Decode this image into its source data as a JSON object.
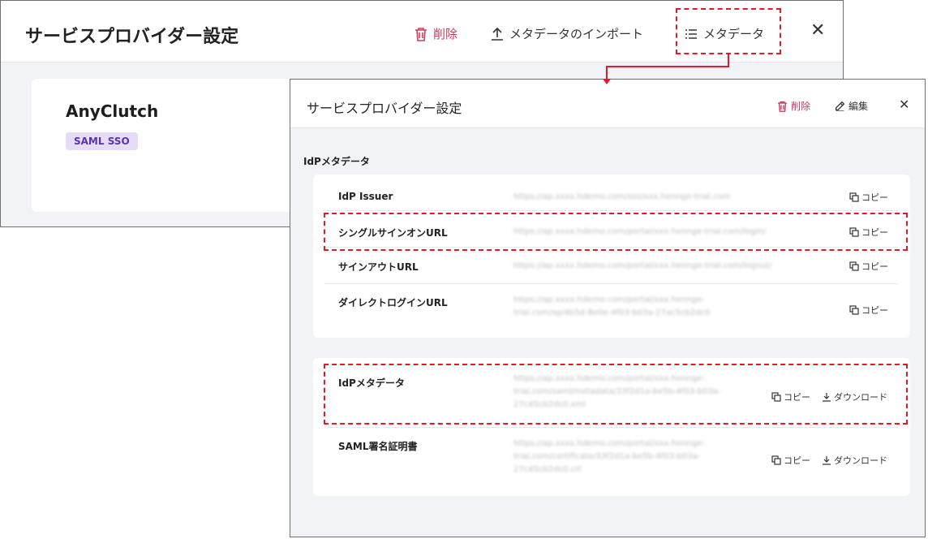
{
  "back_panel": {
    "title": "サービスプロバイダー設定",
    "actions": {
      "delete_label": "削除",
      "import_label": "メタデータのインポート",
      "metadata_label": "メタデータ"
    },
    "app_name": "AnyClutch",
    "badge": "SAML SSO"
  },
  "front_panel": {
    "title": "サービスプロバイダー設定",
    "delete_label": "削除",
    "edit_label": "編集",
    "section_title": "IdPメタデータ",
    "copy_label": "コピー",
    "download_label": "ダウンロード",
    "card1_rows": [
      {
        "label": "IdP Issuer",
        "value": "https://ap.xxxx.hdemo.com/sso/xxx.hennge-trial.com"
      },
      {
        "label": "シングルサインオンURL",
        "value": "https://ap.xxxx.hdemo.com/portal/xxx.hennge-trial.com/login/"
      },
      {
        "label": "サインアウトURL",
        "value": "https://ap.xxxx.hdemo.com/portal/xxx.hennge-trial.com/logout/"
      },
      {
        "label": "ダイレクトログインURL",
        "value": "https://ap.xxxx.hdemo.com/portal/xxx.hennge-trial.com/sp/4b5d-8e0e-4f03-b03a-27ac5cb2dc0"
      }
    ],
    "card2_rows": [
      {
        "label": "IdPメタデータ",
        "value": "https://ap.xxxx.hdemo.com/portal/xxx.hennge-trial.com/saml/metadata/33f2d1a-be5b-4f03-b03a-27c45cb2dc0.xml"
      },
      {
        "label": "SAML署名証明書",
        "value": "https://ap.xxxx.hdemo.com/portal/xxx.hennge-trial.com/certificate/33f2d1a-be5b-4f03-b03a-27c45cb2dc0.crt"
      }
    ]
  },
  "colors": {
    "danger": "#d03a5a",
    "callout": "#e3182a",
    "badge_bg": "#e6dcf7",
    "badge_text": "#5b35a8"
  },
  "icons": [
    "trash-icon",
    "upload-icon",
    "list-icon",
    "close-icon",
    "edit-icon",
    "copy-icon",
    "download-icon"
  ]
}
